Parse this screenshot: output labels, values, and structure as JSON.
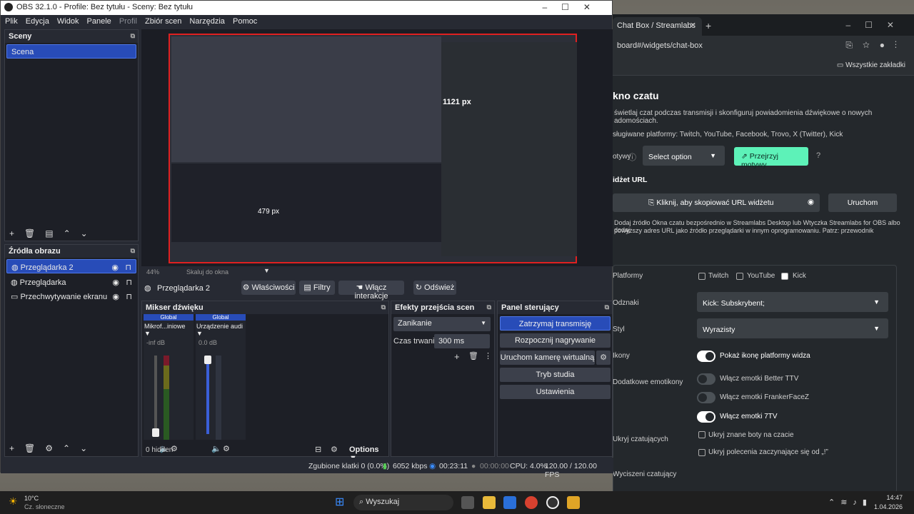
{
  "obs": {
    "title": "OBS 32.1.0 - Profile: Bez tytułu - Sceny: Bez tytułu",
    "menu": [
      "Plik",
      "Edycja",
      "Widok",
      "Panele",
      "Profil",
      "Zbiór scen",
      "Narzędzia",
      "Pomoc"
    ],
    "scenes": {
      "title": "Sceny",
      "items": [
        "Scena"
      ]
    },
    "sources": {
      "title": "Źródła obrazu",
      "items": [
        "Przeglądarka 2",
        "Przeglądarka",
        "Przechwytywanie ekranu"
      ]
    },
    "preview": {
      "zoom": "44%",
      "scale_label": "Skaluj do okna",
      "width_readout": "1121 px",
      "height_readout": "479 px"
    },
    "source_toolbar": {
      "source_name": "Przeglądarka 2",
      "properties": "Właściwości",
      "filters": "Filtry",
      "interact": "Włącz interakcje",
      "refresh": "Odśwież"
    },
    "mixer": {
      "title": "Mikser dźwięku",
      "channels": [
        {
          "tag": "Global",
          "name": "Mikrof...iniowe",
          "level": "-inf dB"
        },
        {
          "tag": "Global",
          "name": "Urządzenie audi",
          "level": "0.0 dB"
        }
      ],
      "scale": [
        "0",
        "-6",
        "-12",
        "-18",
        "-24",
        "-30",
        "-36",
        "-42",
        "-48",
        "-54",
        "-60"
      ],
      "hidden": "0 hidden",
      "options": "Options"
    },
    "transitions": {
      "title": "Efekty przejścia scen",
      "type": "Zanikanie",
      "duration_label": "Czas trwania",
      "duration": "300 ms"
    },
    "controls": {
      "title": "Panel sterujący",
      "stop_stream": "Zatrzymaj transmisję",
      "record": "Rozpocznij nagrywanie",
      "virtual_cam": "Uruchom kamerę wirtualną",
      "studio": "Tryb studia",
      "settings": "Ustawienia"
    },
    "status": {
      "dropped": "Zgubione klatki 0 (0.0%)",
      "bitrate": "6052 kbps",
      "stream_time": "00:23:11",
      "rec_time": "00:00:00",
      "cpu": "CPU: 4.0%",
      "fps": "120.00 / 120.00 FPS"
    }
  },
  "browser": {
    "tab_title": "Chat Box / Streamlabs",
    "address": "board#/widgets/chat-box",
    "bookmarks": "Wszystkie zakładki",
    "page": {
      "heading": "kno czatu",
      "desc": "świetlaj czat podczas transmisji i skonfiguruj powiadomienia dźwiękowe o nowych",
      "desc2": "adomościach.",
      "platforms": "sługiwane platformy: Twitch, YouTube, Facebook, Trovo, X (Twitter), Kick",
      "theme_label": "otywy",
      "select_option": "Select option",
      "theme_button": "Przejrzyj motywy",
      "widget_url": "idżet URL",
      "copy_url": "Kliknij, aby skopiować URL widżetu",
      "launch": "Uruchom",
      "info": "Dodaj źródło Okna czatu bezpośrednio w Streamlabs Desktop lub Wtyczka Streamlabs for OBS albo dodaj",
      "info2": "powyższy adres URL jako źródło przeglądarki w innym oprogramowaniu. Patrz: przewodnik",
      "form": {
        "platforms_label": "Platformy",
        "platforms": [
          "Twitch",
          "YouTube",
          "Kick"
        ],
        "mentions_label": "Odznaki",
        "mentions_value": "Kick: Subskrybent;",
        "style_label": "Styl",
        "style_value": "Wyrazisty",
        "icons_label": "Ikony",
        "icons_toggle": "Pokaż ikonę platformy widza",
        "emotes_label": "Dodatkowe emotikony",
        "emotes": [
          {
            "label": "Włącz emotki Better TTV",
            "on": false
          },
          {
            "label": "Włącz emotki FrankerFaceZ",
            "on": false
          },
          {
            "label": "Włącz emotki 7TV",
            "on": true
          }
        ],
        "hide_label": "Ukryj czatujących",
        "hide_bots": "Ukryj znane boty na czacie",
        "hide_commands": "Ukryj polecenia zaczynające się od „!”",
        "muted_label": "Wyciszeni czatujący"
      }
    }
  },
  "taskbar": {
    "weather_temp": "10°C",
    "weather_desc": "Cz. słoneczne",
    "search": "Wyszukaj",
    "time": "14:47",
    "date": "1.04.2026"
  },
  "colors": {
    "accent": "#284cb8",
    "green_btn": "#5df2b8"
  }
}
